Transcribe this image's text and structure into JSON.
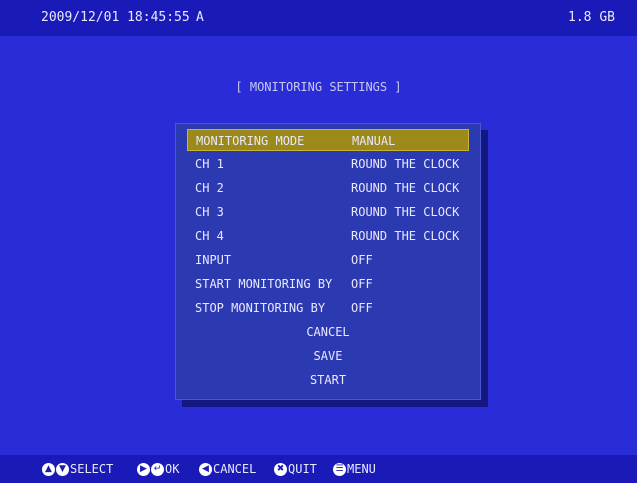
{
  "topbar": {
    "datetime": "2009/12/01 18:45:55",
    "channel": "A",
    "storage": "1.8 GB"
  },
  "title": "[ MONITORING SETTINGS ]",
  "settings": [
    {
      "label": "MONITORING MODE",
      "value": "MANUAL",
      "selected": true
    },
    {
      "label": "CH 1",
      "value": "ROUND THE CLOCK"
    },
    {
      "label": "CH 2",
      "value": "ROUND THE CLOCK"
    },
    {
      "label": "CH 3",
      "value": "ROUND THE CLOCK"
    },
    {
      "label": "CH 4",
      "value": "ROUND THE CLOCK"
    },
    {
      "label": "INPUT",
      "value": "OFF"
    },
    {
      "label": "START MONITORING BY",
      "value": "OFF"
    },
    {
      "label": "STOP MONITORING BY",
      "value": "OFF"
    }
  ],
  "actions": {
    "cancel": "CANCEL",
    "save": "SAVE",
    "start": "START"
  },
  "hints": {
    "select": "SELECT",
    "ok": "OK",
    "cancel": "CANCEL",
    "quit": "QUIT",
    "menu": "MENU"
  },
  "colors": {
    "background": "#2a2cd8",
    "bar": "#1a1ab8",
    "panel": "#2c3ab2",
    "highlight": "#9b8a1a"
  }
}
